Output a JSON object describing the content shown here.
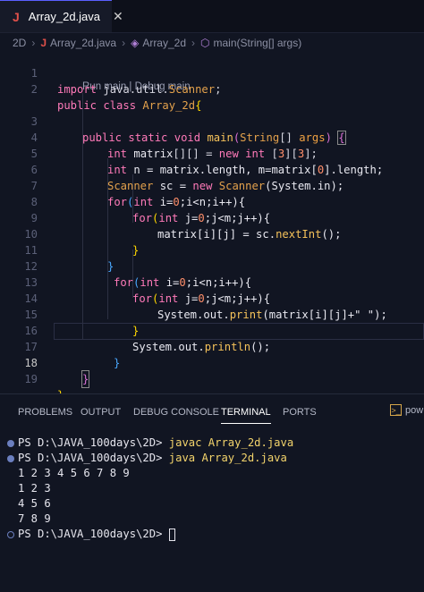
{
  "tab": {
    "icon": "J",
    "title": "Array_2d.java",
    "close": "✕"
  },
  "breadcrumb": [
    "2D",
    "Array_2d.java",
    "Array_2d",
    "main(String[] args)"
  ],
  "codelens": "Run main | Debug main",
  "line_numbers": [
    "1",
    "2",
    "3",
    "4",
    "5",
    "6",
    "7",
    "8",
    "9",
    "10",
    "11",
    "12",
    "13",
    "14",
    "15",
    "16",
    "17",
    "18",
    "19"
  ],
  "code": {
    "l1": [
      "import",
      " java.util.",
      "Scanner",
      ";"
    ],
    "l2": [
      "public",
      " ",
      "class",
      " ",
      "Array_2d",
      "{"
    ],
    "l3": [
      "public",
      " ",
      "static",
      " ",
      "void",
      " ",
      "main",
      "(",
      "String",
      "[] ",
      "args",
      ") ",
      "{"
    ],
    "l4": [
      "int",
      " matrix",
      "[][]",
      " = ",
      "new",
      " ",
      "int",
      " [",
      "3",
      "][",
      "3",
      "];"
    ],
    "l5": [
      "int",
      " n = matrix.length, m=matrix[",
      "0",
      "].length;"
    ],
    "l6": [
      "Scanner",
      " sc = ",
      "new",
      " ",
      "Scanner",
      "(System.in);"
    ],
    "l7": [
      "for",
      "(",
      "int",
      " i=",
      "0",
      ";i<n;i++){"
    ],
    "l8": [
      "for",
      "(",
      "int",
      " j=",
      "0",
      ";j<m;j++){"
    ],
    "l9": [
      "matrix[i][j] = sc.",
      "nextInt",
      "();"
    ],
    "l10": [
      "}"
    ],
    "l11": [
      "}"
    ],
    "l12": [
      "for",
      "(",
      "int",
      " i=",
      "0",
      ";i<n;i++){"
    ],
    "l13": [
      "for",
      "(",
      "int",
      " j=",
      "0",
      ";j<m;j++){"
    ],
    "l14": [
      "System.out.",
      "print",
      "(matrix[i][j]+\" \");"
    ],
    "l15": [
      "}"
    ],
    "l16": [
      "System.out.",
      "println",
      "();"
    ],
    "l17": [
      "}"
    ],
    "l18": [
      "}"
    ],
    "l19": [
      "}"
    ]
  },
  "panel": {
    "tabs": [
      "PROBLEMS",
      "OUTPUT",
      "DEBUG CONSOLE",
      "TERMINAL",
      "PORTS"
    ],
    "active_tab": "TERMINAL",
    "shell_label": "pow"
  },
  "terminal": {
    "prompt1": "PS D:\\JAVA_100days\\2D> ",
    "cmd1": "javac Array_2d.java",
    "prompt2": "PS D:\\JAVA_100days\\2D> ",
    "cmd2": "java Array_2d.java",
    "out1": "1 2 3 4 5 6 7 8 9",
    "out2": "1 2 3",
    "out3": "4 5 6",
    "out4": "7 8 9",
    "prompt3": "PS D:\\JAVA_100days\\2D> "
  }
}
